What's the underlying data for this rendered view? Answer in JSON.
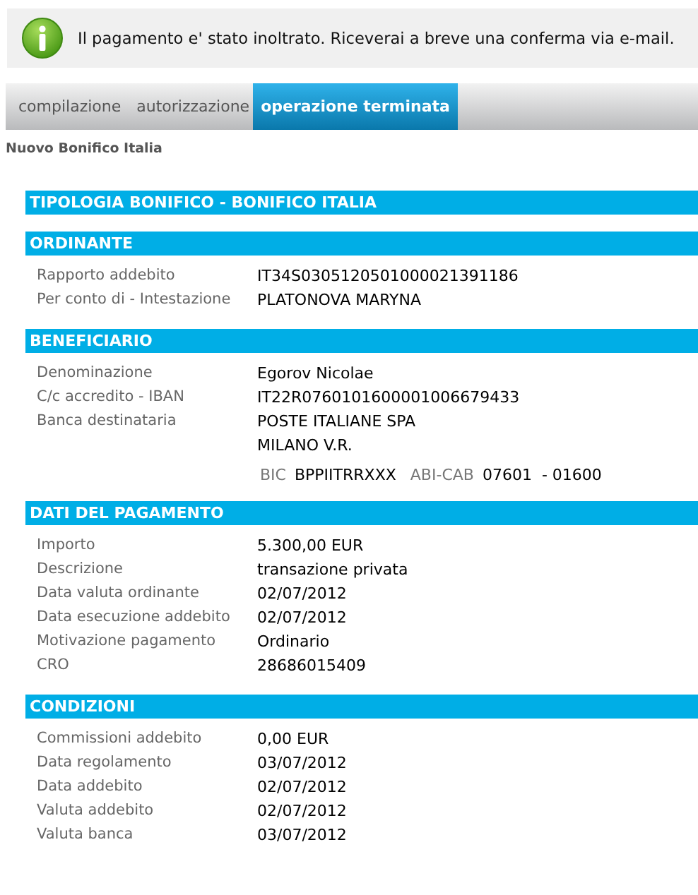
{
  "notice": {
    "message": "Il pagamento e' stato inoltrato. Riceverai a breve una conferma via e-mail."
  },
  "steps": [
    {
      "label": "compilazione",
      "selected": false
    },
    {
      "label": "autorizzazione",
      "selected": false
    },
    {
      "label": "operazione terminata",
      "selected": true
    }
  ],
  "page_title": "Nuovo Bonifico Italia",
  "sections": [
    {
      "title": "TIPOLOGIA BONIFICO - BONIFICO ITALIA"
    },
    {
      "title": "ORDINANTE",
      "rows": [
        {
          "label": "Rapporto addebito",
          "values": [
            "IT34S0305120501000021391186"
          ]
        },
        {
          "label": "Per conto di - Intestazione",
          "values": [
            "PLATONOVA MARYNA"
          ]
        }
      ]
    },
    {
      "title": "BENEFICIARIO",
      "rows": [
        {
          "label": "Denominazione",
          "values": [
            "Egorov Nicolae"
          ]
        },
        {
          "label": "C/c accredito - IBAN",
          "values": [
            "IT22R0760101600001006679433"
          ]
        },
        {
          "label": "Banca destinataria",
          "values": [
            "POSTE ITALIANE SPA",
            "MILANO V.R."
          ]
        }
      ],
      "codes": [
        {
          "label": "BIC",
          "value": "BPPIITRRXXX"
        },
        {
          "label": "ABI-CAB",
          "value": "07601  - 01600"
        }
      ]
    },
    {
      "title": "DATI DEL PAGAMENTO",
      "rows": [
        {
          "label": "Importo",
          "values": [
            "5.300,00 EUR"
          ]
        },
        {
          "label": "Descrizione",
          "values": [
            "transazione privata"
          ]
        },
        {
          "label": "Data valuta ordinante",
          "values": [
            "02/07/2012"
          ]
        },
        {
          "label": "Data esecuzione addebito",
          "values": [
            "02/07/2012"
          ]
        },
        {
          "label": "Motivazione pagamento",
          "values": [
            "Ordinario"
          ]
        },
        {
          "label": "CRO",
          "values": [
            "28686015409"
          ]
        }
      ]
    },
    {
      "title": "CONDIZIONI",
      "rows": [
        {
          "label": "Commissioni addebito",
          "values": [
            "0,00 EUR"
          ]
        },
        {
          "label": "Data regolamento",
          "values": [
            "03/07/2012"
          ]
        },
        {
          "label": "Data addebito",
          "values": [
            "02/07/2012"
          ]
        },
        {
          "label": "Valuta addebito",
          "values": [
            "02/07/2012"
          ]
        },
        {
          "label": "Valuta banca",
          "values": [
            "03/07/2012"
          ]
        }
      ]
    }
  ]
}
